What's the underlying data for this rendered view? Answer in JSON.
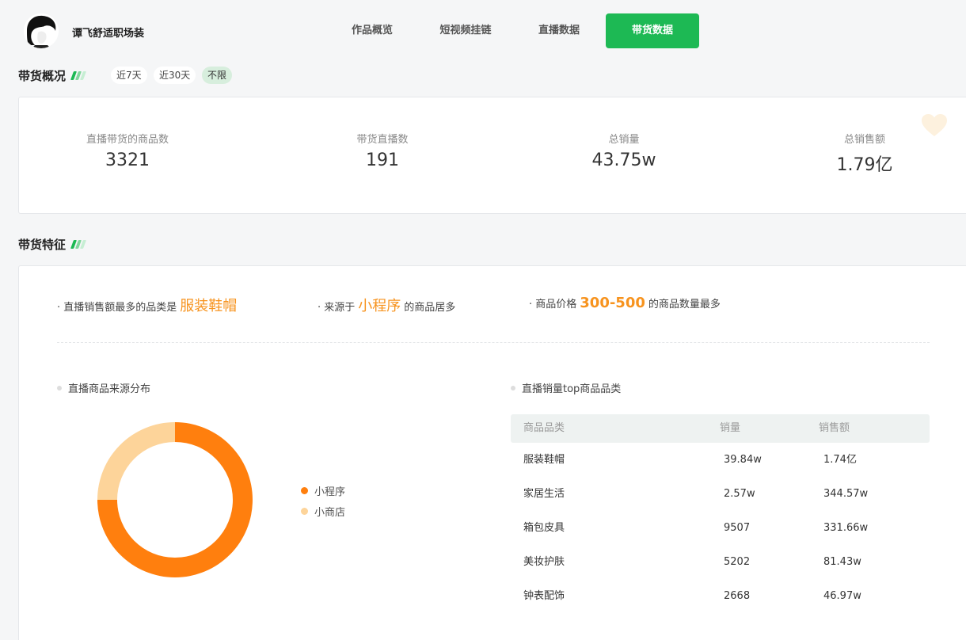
{
  "header": {
    "username": "谭飞舒适职场装",
    "tabs": [
      {
        "label": "作品概览",
        "active": false
      },
      {
        "label": "短视频挂链",
        "active": false
      },
      {
        "label": "直播数据",
        "active": false
      },
      {
        "label": "带货数据",
        "active": true
      }
    ]
  },
  "overview": {
    "title": "带货概况",
    "filters": [
      {
        "label": "近7天",
        "active": false
      },
      {
        "label": "近30天",
        "active": false
      },
      {
        "label": "不限",
        "active": true
      }
    ],
    "stats": [
      {
        "label": "直播带货的商品数",
        "value": "3321"
      },
      {
        "label": "带货直播数",
        "value": "191"
      },
      {
        "label": "总销量",
        "value": "43.75w"
      },
      {
        "label": "总销售额",
        "value": "1.79亿"
      }
    ]
  },
  "features": {
    "title": "带货特征",
    "items": [
      {
        "prefix": "· 直播销售额最多的品类是",
        "highlight": "服装鞋帽",
        "suffix": ""
      },
      {
        "prefix": "· 来源于",
        "highlight": "小程序",
        "suffix": "的商品居多"
      },
      {
        "prefix": "· 商品价格",
        "highlight": "300-500",
        "suffix": "的商品数量最多"
      }
    ]
  },
  "source_chart": {
    "title": "直播商品来源分布",
    "legend": [
      "小程序",
      "小商店"
    ]
  },
  "chart_data": {
    "type": "pie",
    "variant": "donut",
    "slices": [
      {
        "name": "小程序",
        "value": 75,
        "color": "#ff7f0e"
      },
      {
        "name": "小商店",
        "value": 25,
        "color": "#fdd49a"
      }
    ]
  },
  "top_categories": {
    "title": "直播销量top商品品类",
    "columns": [
      "商品品类",
      "销量",
      "销售额"
    ],
    "rows": [
      [
        "服装鞋帽",
        "39.84w",
        "1.74亿"
      ],
      [
        "家居生活",
        "2.57w",
        "344.57w"
      ],
      [
        "箱包皮具",
        "9507",
        "331.66w"
      ],
      [
        "美妆护肤",
        "5202",
        "81.43w"
      ],
      [
        "钟表配饰",
        "2668",
        "46.97w"
      ]
    ]
  },
  "colors": {
    "accent": "#1db954",
    "highlight": "#f7931e"
  }
}
